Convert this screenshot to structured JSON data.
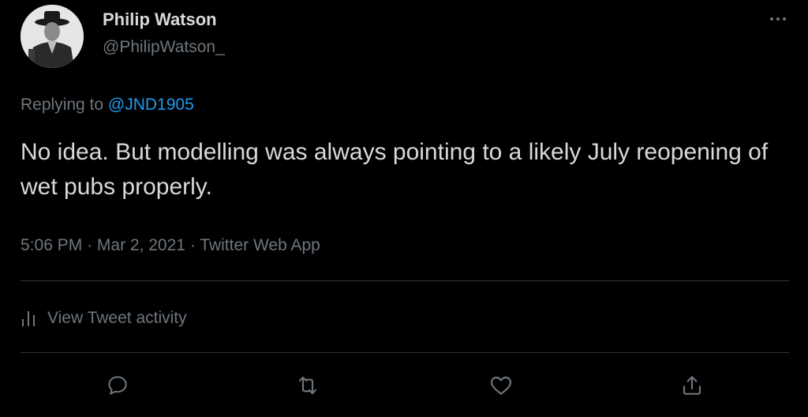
{
  "author": {
    "display_name": "Philip Watson",
    "handle": "@PhilipWatson_"
  },
  "reply": {
    "prefix": "Replying to",
    "mention": "@JND1905"
  },
  "tweet": {
    "text": "No idea. But modelling was always pointing to a likely July reopening of wet pubs properly.",
    "time": "5:06 PM",
    "date": "Mar 2, 2021",
    "source": "Twitter Web App",
    "separator": "·"
  },
  "activity": {
    "label": "View Tweet activity"
  },
  "actions": {
    "reply_icon": "reply-icon",
    "retweet_icon": "retweet-icon",
    "like_icon": "like-icon",
    "share_icon": "share-icon"
  },
  "colors": {
    "background": "#000000",
    "primary_text": "#d9d9d9",
    "secondary_text": "#6e767d",
    "link": "#1d9bf0",
    "divider": "#2f3336"
  }
}
